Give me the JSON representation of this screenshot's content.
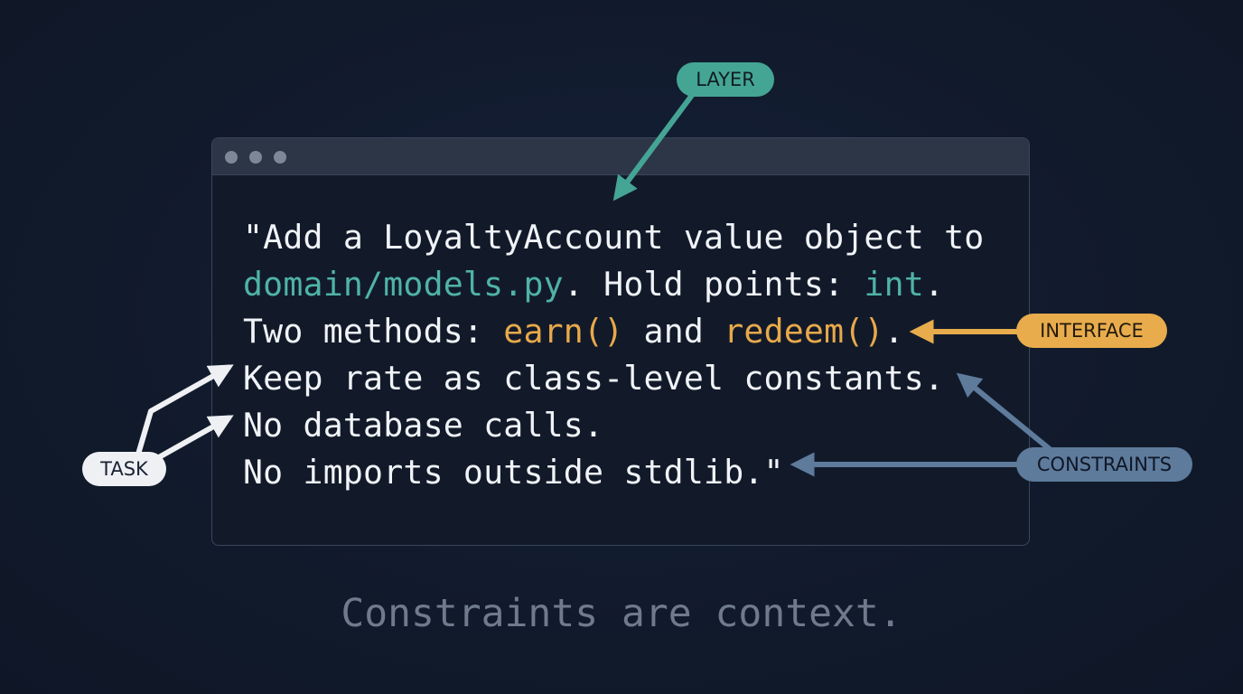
{
  "window": {
    "lines": [
      [
        {
          "text": "\"Add a LoyaltyAccount value object to",
          "color": "plain"
        }
      ],
      [
        {
          "text": "domain/models.py",
          "color": "teal"
        },
        {
          "text": ". Hold points: ",
          "color": "plain"
        },
        {
          "text": "int",
          "color": "teal"
        },
        {
          "text": ".",
          "color": "plain"
        }
      ],
      [
        {
          "text": "Two methods: ",
          "color": "plain"
        },
        {
          "text": "earn()",
          "color": "orange"
        },
        {
          "text": " and ",
          "color": "plain"
        },
        {
          "text": "redeem()",
          "color": "orange"
        },
        {
          "text": ".",
          "color": "plain"
        }
      ],
      [
        {
          "text": "Keep rate as class-level constants.",
          "color": "plain"
        }
      ],
      [
        {
          "text": "No database calls.",
          "color": "plain"
        }
      ],
      [
        {
          "text": "No imports outside stdlib.\"",
          "color": "plain"
        }
      ]
    ]
  },
  "labels": {
    "layer": "LAYER",
    "interface": "INTERFACE",
    "constraints": "CONSTRAINTS",
    "task": "TASK"
  },
  "tagline": "Constraints are context.",
  "colors": {
    "background": "#111a2b",
    "teal": "#4fb3a6",
    "orange": "#e8a94a",
    "blue": "#5e7b9c",
    "white": "#eef0f3",
    "muted": "#6f7b8d"
  }
}
